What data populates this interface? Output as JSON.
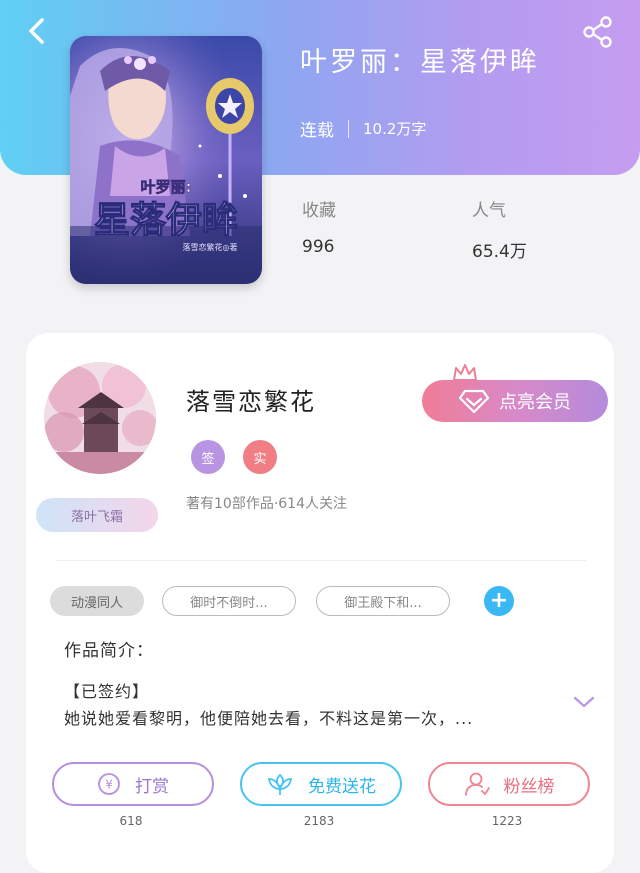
{
  "book": {
    "title": "叶罗丽：星落伊眸",
    "status": "连载",
    "word_count": "10.2万字",
    "cover": {
      "series_text": "叶罗丽:",
      "title_text": "星落伊眸",
      "author_text": "落雪恋繁花◎著"
    }
  },
  "stats": {
    "favorites_label": "收藏",
    "favorites_value": "996",
    "popularity_label": "人气",
    "popularity_value": "65.4万"
  },
  "author": {
    "name": "落雪恋繁花",
    "badge_signed": "签",
    "badge_real": "实",
    "tag": "落叶飞霜",
    "stats_text": "著有10部作品·614人关注",
    "vip_label": "点亮会员"
  },
  "tags": {
    "genre": "动漫同人",
    "pills": [
      "御时不倒时...",
      "御王殿下和..."
    ],
    "add": "+"
  },
  "intro": {
    "title": "作品简介：",
    "signed": "【已签约】",
    "text": "她说她爱看黎明，他便陪她去看，不料这是第一次，..."
  },
  "actions": [
    {
      "label": "打赏",
      "count": "618",
      "color": "#b58ee0",
      "icon": "yen-coin-icon"
    },
    {
      "label": "免费送花",
      "count": "2183",
      "color": "#45c4f2",
      "icon": "flower-icon"
    },
    {
      "label": "粉丝榜",
      "count": "1223",
      "color": "#f08591",
      "icon": "fans-user-icon"
    }
  ],
  "colors": {
    "header_gradient_start": "#5fd0f3",
    "header_gradient_end": "#c59df0",
    "accent_blue": "#39b8f4",
    "badge_purple": "#b994e3",
    "badge_red": "#f07e84"
  }
}
